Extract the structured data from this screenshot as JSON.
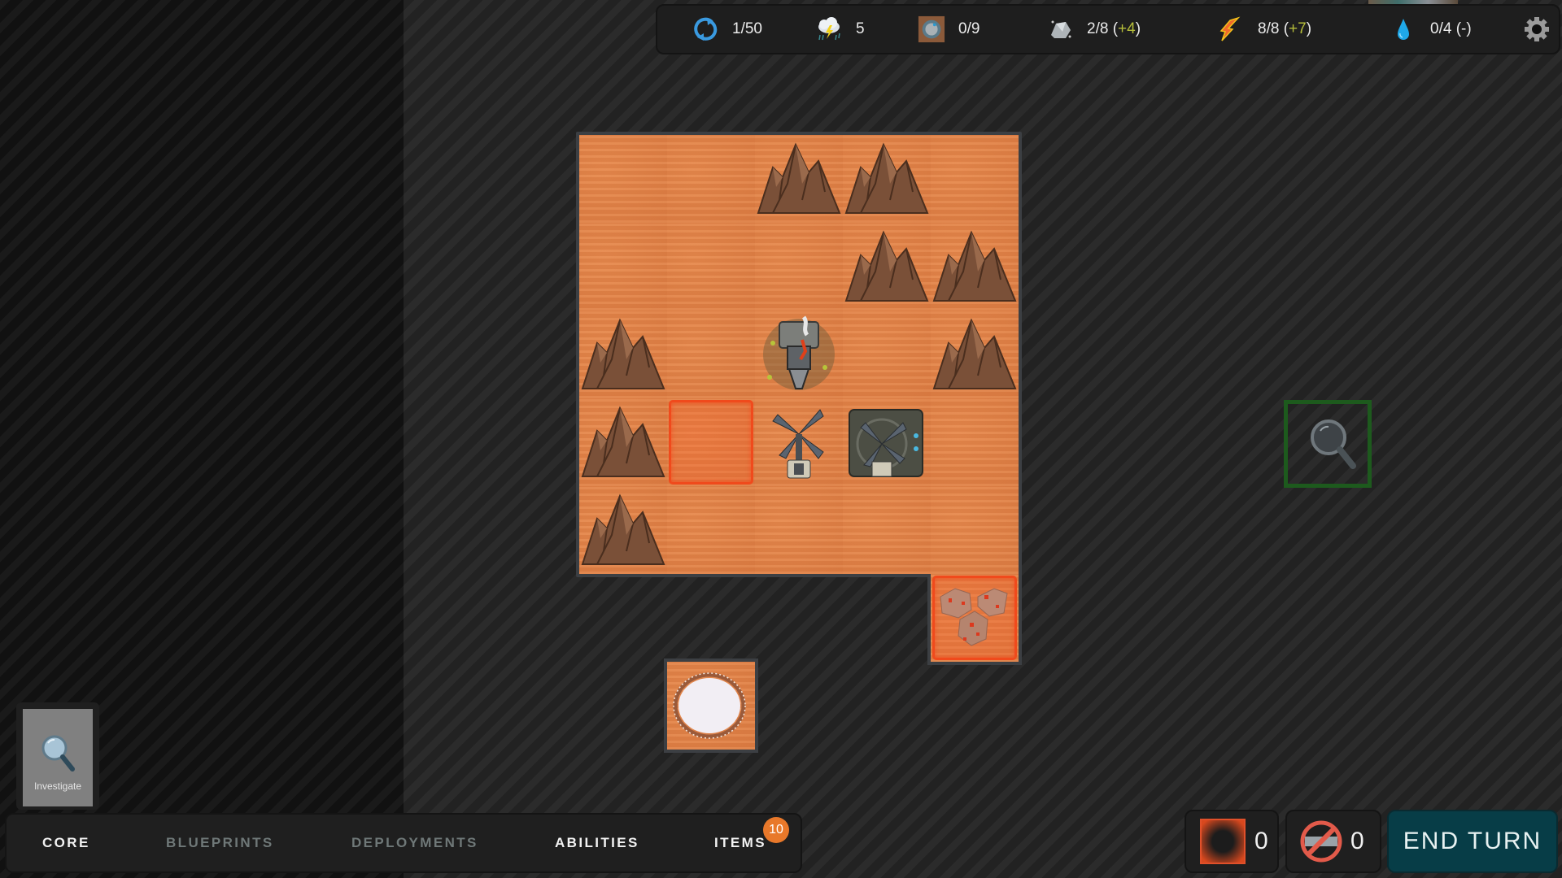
{
  "resources": [
    {
      "name": "turn",
      "icon": "cycle-arrows-icon",
      "value": "1/50",
      "bonus": null,
      "suffix": null
    },
    {
      "name": "weather",
      "icon": "storm-cloud-icon",
      "value": "5",
      "bonus": null,
      "suffix": null
    },
    {
      "name": "cores",
      "icon": "core-tile-icon",
      "value": "0/9",
      "bonus": null,
      "suffix": null
    },
    {
      "name": "metal",
      "icon": "ore-rock-icon",
      "value": "2/8",
      "bonus": "+4",
      "suffix": null
    },
    {
      "name": "energy",
      "icon": "lightning-bolt-icon",
      "value": "8/8",
      "bonus": "+7",
      "suffix": null
    },
    {
      "name": "water",
      "icon": "water-drop-icon",
      "value": "0/4",
      "bonus": null,
      "suffix": "(-)"
    }
  ],
  "settings_icon": "gear-icon",
  "board": {
    "tiles": [
      {
        "row": 0,
        "col": 0,
        "content": "sand"
      },
      {
        "row": 0,
        "col": 1,
        "content": "sand"
      },
      {
        "row": 0,
        "col": 2,
        "content": "mountain"
      },
      {
        "row": 0,
        "col": 3,
        "content": "mountain"
      },
      {
        "row": 0,
        "col": 4,
        "content": "sand"
      },
      {
        "row": 1,
        "col": 0,
        "content": "sand"
      },
      {
        "row": 1,
        "col": 1,
        "content": "sand"
      },
      {
        "row": 1,
        "col": 2,
        "content": "sand"
      },
      {
        "row": 1,
        "col": 3,
        "content": "mountain"
      },
      {
        "row": 1,
        "col": 4,
        "content": "mountain"
      },
      {
        "row": 2,
        "col": 0,
        "content": "mountain"
      },
      {
        "row": 2,
        "col": 1,
        "content": "sand"
      },
      {
        "row": 2,
        "col": 2,
        "content": "crashed-drill"
      },
      {
        "row": 2,
        "col": 3,
        "content": "sand"
      },
      {
        "row": 2,
        "col": 4,
        "content": "mountain"
      },
      {
        "row": 3,
        "col": 0,
        "content": "mountain"
      },
      {
        "row": 3,
        "col": 1,
        "content": "highlight"
      },
      {
        "row": 3,
        "col": 2,
        "content": "wind-turbine"
      },
      {
        "row": 3,
        "col": 3,
        "content": "turbine-building"
      },
      {
        "row": 3,
        "col": 4,
        "content": "sand"
      },
      {
        "row": 4,
        "col": 0,
        "content": "mountain"
      },
      {
        "row": 4,
        "col": 1,
        "content": "sand"
      },
      {
        "row": 4,
        "col": 2,
        "content": "sand"
      },
      {
        "row": 4,
        "col": 3,
        "content": "sand"
      },
      {
        "row": 4,
        "col": 4,
        "content": "sand"
      }
    ],
    "extra_tiles": [
      {
        "name": "crystal-rock-tile",
        "content": "crystal-rocks",
        "highlighted": true
      },
      {
        "name": "salt-crater-tile",
        "content": "salt-crater",
        "highlighted": false
      }
    ],
    "investigate_marker": "magnifier-icon"
  },
  "ability_card": {
    "label": "Investigate",
    "icon": "magnifier-icon"
  },
  "nav": {
    "tabs": [
      {
        "label": "CORE",
        "state": "active"
      },
      {
        "label": "BLUEPRINTS",
        "state": "dim"
      },
      {
        "label": "DEPLOYMENTS",
        "state": "dim"
      },
      {
        "label": "ABILITIES",
        "state": "active"
      },
      {
        "label": "ITEMS",
        "state": "active"
      }
    ],
    "items_badge": "10"
  },
  "counters": [
    {
      "name": "tile-counter",
      "icon": "red-square-icon",
      "value": "0"
    },
    {
      "name": "blocked-counter",
      "icon": "prohibited-icon",
      "value": "0"
    }
  ],
  "end_turn_label": "END TURN",
  "colors": {
    "accent_plus": "#b5bd3a",
    "highlight": "#f04a1c",
    "end_turn_bg": "#073d47",
    "badge": "#e8782a",
    "investigate_border": "#1d5a1d"
  }
}
